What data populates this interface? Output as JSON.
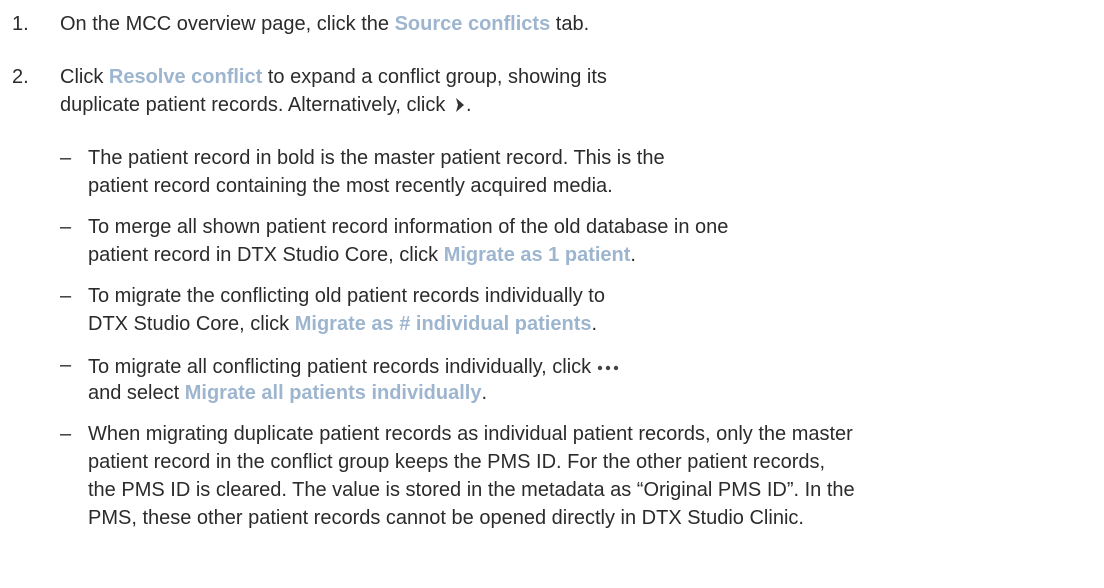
{
  "steps": [
    {
      "number": "1.",
      "lines": [
        {
          "pre": "On the MCC overview page, click the ",
          "ui": "Source conflicts",
          "post": " tab."
        }
      ]
    },
    {
      "number": "2.",
      "line1": {
        "pre": "Click ",
        "ui": "Resolve conflict",
        "post": " to expand a conflict group, showing its"
      },
      "line2": {
        "pre": "duplicate patient records. Alternatively, click ",
        "post": "."
      }
    }
  ],
  "bullets": [
    {
      "dash": "–",
      "l1": "The patient record in bold is the master patient record. This is the",
      "l2": "patient record containing the most recently acquired media."
    },
    {
      "dash": "–",
      "l1": "To merge all shown patient record information of the old database in one",
      "l2_pre": "patient record in DTX Studio Core, click ",
      "l2_ui": "Migrate as 1 patient",
      "l2_post": "."
    },
    {
      "dash": "–",
      "l1": "To migrate the conflicting old patient records individually to",
      "l2_pre": "DTX Studio Core, click ",
      "l2_ui": "Migrate as # individual patients",
      "l2_post": "."
    },
    {
      "dash": "–",
      "l1": "To migrate all conflicting patient records individually, click",
      "l2_pre": "and select ",
      "l2_ui": "Migrate all patients individually",
      "l2_post": "."
    },
    {
      "dash": "–",
      "l1": "When migrating duplicate patient records as individual patient records, only the master",
      "l2": "patient record in the conflict group keeps the PMS ID. For the other patient records,",
      "l3": "the PMS ID is cleared. The value is stored in the metadata as “Original PMS ID”. In the",
      "l4": "PMS, these other patient records cannot be opened directly in DTX Studio Clinic."
    }
  ],
  "icons": {
    "chevron": "chevron-right-icon",
    "more": "more-dots-icon"
  },
  "colors": {
    "ui_text": "#9db5cf",
    "body_text": "#2b2b2b"
  }
}
